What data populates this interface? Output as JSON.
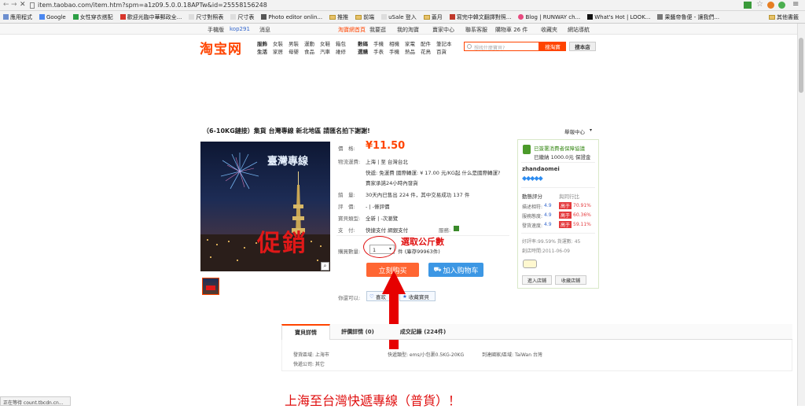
{
  "browser": {
    "url": "item.taobao.com/item.htm?spm=a1z09.5.0.0.18APTw&id=25558156248",
    "bookmarks": [
      {
        "label": "應用程式",
        "icon": "grid"
      },
      {
        "label": "Google",
        "icon": "g"
      },
      {
        "label": "女性穿衣搭配",
        "icon": "f"
      },
      {
        "label": "歡迎光臨中華郵政全...",
        "icon": "r"
      },
      {
        "label": "尺寸對照表",
        "icon": "f"
      },
      {
        "label": "尺寸表",
        "icon": "f"
      },
      {
        "label": "Photo editor onlin...",
        "icon": "f"
      },
      {
        "label": "推推",
        "icon": "f"
      },
      {
        "label": "前端",
        "icon": "f"
      },
      {
        "label": "uSale 登入",
        "icon": "f"
      },
      {
        "label": "蓋月",
        "icon": "f"
      },
      {
        "label": "寫完中韓文翻譯對照...",
        "icon": "f"
      },
      {
        "label": "Blog | RUNWAY ch...",
        "icon": "r"
      },
      {
        "label": "What's Hot | LOOK...",
        "icon": "f"
      },
      {
        "label": "果醬帝魯便 - 讓我們...",
        "icon": "f"
      },
      {
        "label": "其他書籤",
        "icon": "f"
      }
    ],
    "status": "正在等待 count.tbcdn.cn..."
  },
  "topnav": {
    "left": [
      "手機版",
      "kop291",
      "消息"
    ],
    "items": [
      "淘寶網首頁",
      "我要逛",
      "我的淘寶",
      "賣家中心",
      "聯系客服",
      "購物車 26 件",
      "收藏夾",
      "網站導航"
    ]
  },
  "header": {
    "logo": "淘宝网",
    "cat_row1": [
      "服飾",
      "女裝",
      "男裝",
      "運動",
      "女鞋",
      "箱包",
      "數碼",
      "手機",
      "相機",
      "家電",
      "配件",
      "筆記本"
    ],
    "cat_row2": [
      "生活",
      "家居",
      "母嬰",
      "食品",
      "汽車",
      "維修",
      "選購",
      "手表",
      "手機",
      "熱品",
      "花鳥",
      "百貨"
    ],
    "search_placeholder": "想找什麼寶貝?",
    "search_button": "搜淘寶",
    "search_shop": "搜本店"
  },
  "product": {
    "title": "（6-10KG鏈接）集貨 台灣專線 新北地區 請匯名拍下謝謝!",
    "report": "舉報中心",
    "price_label": "價　格:",
    "price": "¥11.50",
    "shipping_label": "物流運費:",
    "shipping_route": "上海 | 至 台灣台北",
    "shipping_detail": "快遞: 免運費 國際轉運: ¥ 17.00 元/KG起 什么是國際轉運?",
    "shipping_note": "賣家承諾24小時內發貨",
    "sales_label": "銷　量:",
    "sales_text": "30天內已售出 224 件，其中交易成功 137 件",
    "rating_label": "評　價:",
    "rating_text": "-  |  -條評價",
    "type_label": "寶貝類型:",
    "type_text": "全新  |  -次瀏覽",
    "pay_label": "支　付:",
    "pay_text": "快捷支付  網銀支付",
    "service_label": "服務:",
    "qty_label": "購買數量:",
    "qty_value": "1",
    "qty_unit": "件 (庫存99963件)",
    "buy_button": "立刻购买",
    "cart_button": "加入购物车",
    "like_label": "你還可以:",
    "like_button": "喜欢",
    "collect_button": "收藏寶貝",
    "image_text1": "臺灣專線",
    "image_text2": "促銷"
  },
  "annotation": {
    "label": "選取公斤數"
  },
  "shop": {
    "guarantee": "已簽署消費者保障協議",
    "deposit": "已繳納 1000.0元 保證金",
    "seller": "zhandaomei",
    "score_header": "動態評分",
    "compare_header": "與同行比",
    "scores": [
      {
        "label": "描述相符:",
        "value": "4.9",
        "tag": "高于",
        "pct": "70.91%"
      },
      {
        "label": "服務態度:",
        "value": "4.9",
        "tag": "高于",
        "pct": "60.36%"
      },
      {
        "label": "發貨速度:",
        "value": "4.9",
        "tag": "高于",
        "pct": "59.11%"
      }
    ],
    "rate": "好評率:99.59%  貨運數: 45",
    "created": "創店時間:2011-06-09",
    "enter_shop": "進入店鋪",
    "collect_shop": "收藏店鋪"
  },
  "tabs": {
    "items": [
      "寶貝詳情",
      "評價詳情 (0)",
      "成交記錄 (224件)"
    ],
    "details": [
      "發貨區域: 上海市",
      "快遞類型: ems/小包裹0.5KG-20KG",
      "到達國家/區域: TaiWan 台灣",
      "快遞公司: 其它"
    ]
  },
  "banner": "上海至台灣快遞專線（普貨）！"
}
